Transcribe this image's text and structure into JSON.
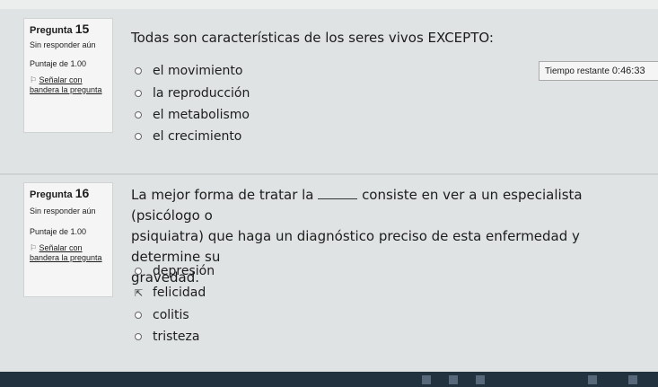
{
  "q15": {
    "label": "Pregunta",
    "number": "15",
    "status": "Sin responder aún",
    "grade": "Puntaje de 1.00",
    "flag": "Señalar con bandera la pregunta",
    "text": "Todas son características de los seres vivos EXCEPTO:",
    "options": [
      "el movimiento",
      "la reproducción",
      "el metabolismo",
      "el crecimiento"
    ]
  },
  "timer": {
    "label": "Tiempo restante",
    "value": "0:46:33"
  },
  "q16": {
    "label": "Pregunta",
    "number": "16",
    "status": "Sin responder aún",
    "grade": "Puntaje de 1.00",
    "flag": "Señalar con bandera la pregunta",
    "text_before": "La mejor forma de tratar la",
    "text_after_line1": "consiste en ver a un especialista (psicólogo o",
    "text_line2": "psiquiatra) que haga un diagnóstico preciso de esta enfermedad y determine su",
    "text_line3": "gravedad.",
    "options": [
      "depresión",
      "felicidad",
      "colitis",
      "tristeza"
    ]
  },
  "icons": {
    "flag": "flag-icon",
    "cursor": "mouse-cursor-icon",
    "radio": "radio-button-icon"
  }
}
